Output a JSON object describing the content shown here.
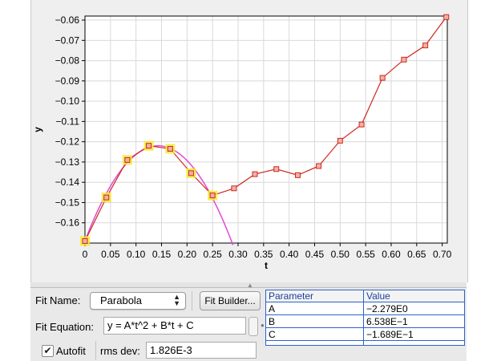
{
  "chart_data": {
    "type": "scatter",
    "xlabel": "t",
    "ylabel": "y",
    "xlim": [
      0,
      0.71
    ],
    "ylim": [
      -0.17,
      -0.058
    ],
    "xticks": [
      0,
      0.05,
      0.1,
      0.15,
      0.2,
      0.25,
      0.3,
      0.35,
      0.4,
      0.45,
      0.5,
      0.55,
      0.6,
      0.65,
      0.7
    ],
    "xtick_labels": [
      "0",
      "0.05",
      "0.10",
      "0.15",
      "0.20",
      "0.25",
      "0.30",
      "0.35",
      "0.40",
      "0.45",
      "0.50",
      "0.55",
      "0.60",
      "0.65",
      "0.70"
    ],
    "yticks": [
      -0.16,
      -0.15,
      -0.14,
      -0.13,
      -0.12,
      -0.11,
      -0.1,
      -0.09,
      -0.08,
      -0.07,
      -0.06
    ],
    "ytick_labels": [
      "−0.16",
      "−0.15",
      "−0.14",
      "−0.13",
      "−0.12",
      "−0.11",
      "−0.10",
      "−0.09",
      "−0.08",
      "−0.07",
      "−0.06"
    ],
    "grid": true,
    "series": [
      {
        "marker": "square",
        "line": "connected",
        "color": "#cc2a1e",
        "x": [
          0,
          0.042,
          0.083,
          0.125,
          0.167,
          0.208,
          0.25,
          0.292,
          0.333,
          0.375,
          0.417,
          0.458,
          0.5,
          0.542,
          0.583,
          0.625,
          0.667,
          0.708
        ],
        "y": [
          -0.169,
          -0.1475,
          -0.129,
          -0.122,
          -0.1235,
          -0.1355,
          -0.1465,
          -0.143,
          -0.136,
          -0.1335,
          -0.1365,
          -0.132,
          -0.1195,
          -0.1115,
          -0.0885,
          -0.0795,
          -0.0725,
          -0.0585
        ]
      }
    ],
    "highlighted_point_indices": [
      0,
      1,
      2,
      3,
      4,
      5,
      6
    ],
    "highlight_color": "#f5ea33",
    "fit_curve": {
      "formula": "y = A*t^2 + B*t + C",
      "A": -2.279,
      "B": 0.6538,
      "C": -0.1689,
      "x_range": [
        0,
        0.29
      ],
      "color": "#e04ad6"
    }
  },
  "fit_panel": {
    "fit_name_label": "Fit Name:",
    "fit_name_value": "Parabola",
    "fit_builder_label": "Fit Builder...",
    "fit_equation_label": "Fit Equation:",
    "fit_equation_value": "y = A*t^2 + B*t + C",
    "autofit_label": "Autofit",
    "autofit_checked": true,
    "rms_label": "rms dev:",
    "rms_value": "1.826E-3"
  },
  "param_table": {
    "headers": [
      "Parameter",
      "Value"
    ],
    "rows": [
      [
        "A",
        "−2.279E0"
      ],
      [
        "B",
        "6.538E−1"
      ],
      [
        "C",
        "−1.689E−1"
      ]
    ]
  },
  "colors": {
    "data_red": "#cc2a1e",
    "fit_magenta": "#e04ad6",
    "highlight_yellow": "#f5ea33",
    "table_blue": "#2f62c6"
  }
}
